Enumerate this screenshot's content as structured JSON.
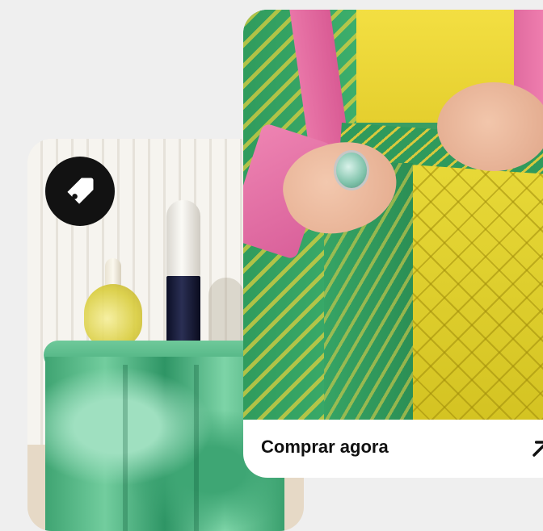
{
  "promo": {
    "cta_label": "Comprar agora",
    "icons": {
      "tag": "price-tag-icon",
      "arrow": "arrow-up-right-icon"
    },
    "colors": {
      "page_background": "#efefef",
      "badge": "#121212",
      "cta_background": "#ffffff",
      "cta_text": "#111111"
    }
  }
}
